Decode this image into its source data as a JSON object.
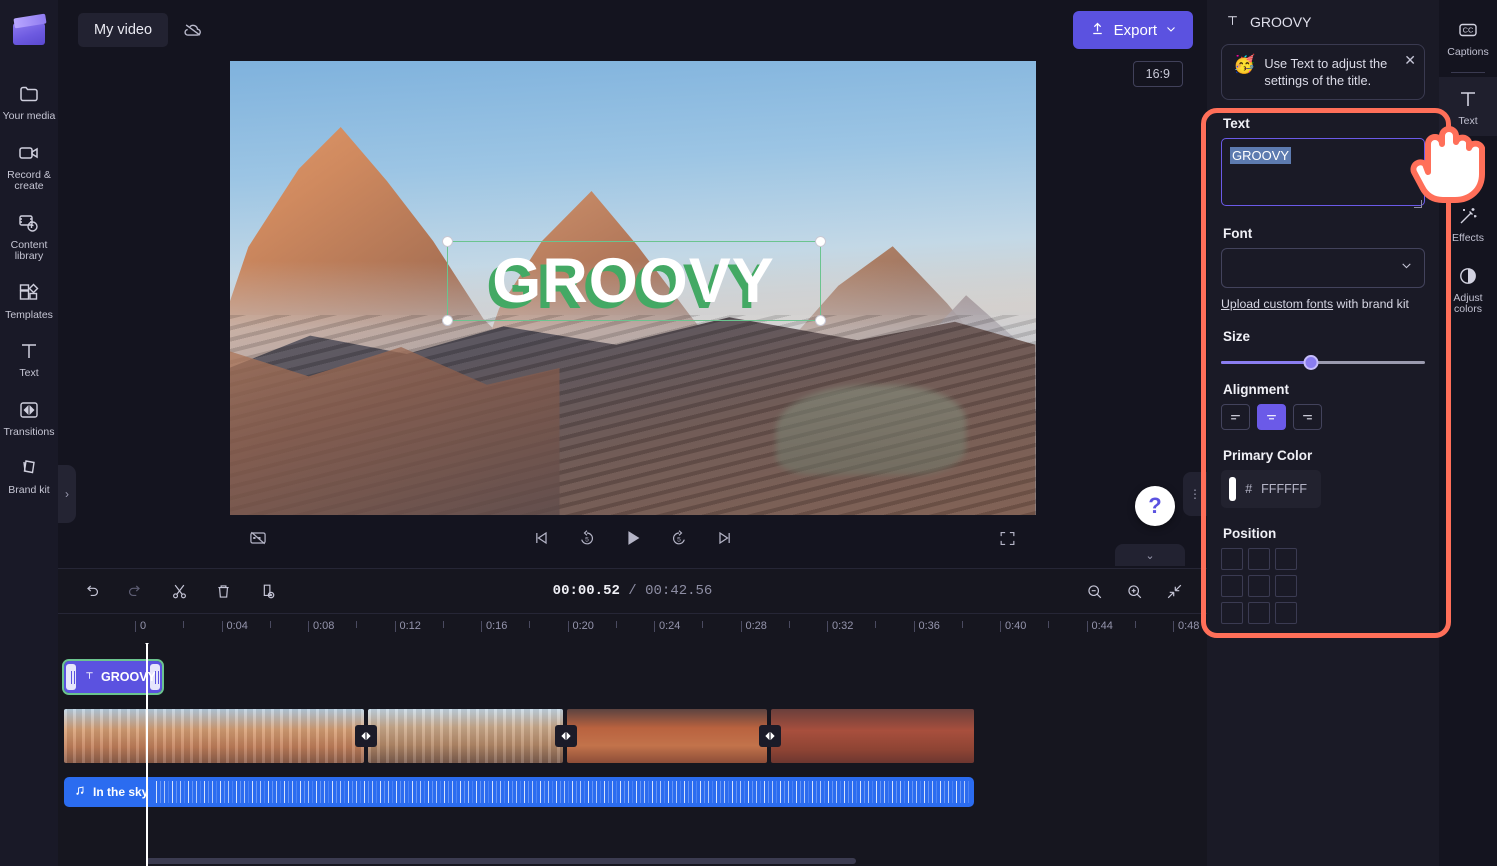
{
  "app": {
    "project_title": "My video",
    "cloud_status_icon": "cloud-off-icon",
    "export_label": "Export",
    "aspect_ratio": "16:9",
    "help_glyph": "?"
  },
  "sidebar": {
    "items": [
      {
        "label": "Your media",
        "icon": "folder-icon"
      },
      {
        "label": "Record & create",
        "icon": "video-camera-icon"
      },
      {
        "label": "Content library",
        "icon": "content-library-icon"
      },
      {
        "label": "Templates",
        "icon": "templates-icon"
      },
      {
        "label": "Text",
        "icon": "text-t-icon"
      },
      {
        "label": "Transitions",
        "icon": "transitions-icon"
      },
      {
        "label": "Brand kit",
        "icon": "brand-kit-icon"
      }
    ]
  },
  "preview": {
    "overlay_text": "GROOVY",
    "text_color": "#FFFFFF",
    "shadow_color": "#43A964",
    "controls": [
      {
        "name": "captions-off-icon"
      },
      {
        "name": "skip-to-start-icon"
      },
      {
        "name": "rewind-5-icon"
      },
      {
        "name": "play-icon"
      },
      {
        "name": "forward-5-icon"
      },
      {
        "name": "skip-to-end-icon"
      },
      {
        "name": "fullscreen-icon"
      }
    ]
  },
  "timeline": {
    "tools": [
      {
        "name": "undo-icon",
        "enabled": true
      },
      {
        "name": "redo-icon",
        "enabled": false
      },
      {
        "name": "split-scissors-icon",
        "enabled": true
      },
      {
        "name": "delete-trash-icon",
        "enabled": true
      },
      {
        "name": "duplicate-icon",
        "enabled": true
      }
    ],
    "current_time": "00:00.52",
    "total_time": "00:42.56",
    "time_separator": "/",
    "zoom_tools": [
      {
        "name": "zoom-out-icon"
      },
      {
        "name": "zoom-in-icon"
      },
      {
        "name": "fit-to-screen-icon"
      }
    ],
    "ruler_labels": [
      "0:04",
      "0:08",
      "0:12",
      "0:16",
      "0:20",
      "0:24",
      "0:28",
      "0:32",
      "0:36",
      "0:40",
      "0:44",
      "0:48"
    ],
    "text_clip_label": "GROOVY",
    "audio_clip_label": "In the sky",
    "audio_icon": "music-note-icon",
    "transition_icon": "transition-bowtie-icon",
    "transition_count": 3
  },
  "right_panel": {
    "header_title": "GROOVY",
    "header_icon": "text-t-icon",
    "tip": {
      "emoji": "🥳",
      "text": "Use Text to adjust the settings of the title.",
      "close_icon": "close-x-icon"
    },
    "text_section": {
      "label": "Text",
      "value": "GROOVY"
    },
    "font_section": {
      "label": "Font",
      "value": "",
      "chevron_icon": "chevron-down-icon",
      "upload_link": "Upload custom fonts",
      "upload_suffix": " with brand kit"
    },
    "size_section": {
      "label": "Size",
      "value_percent": 44
    },
    "alignment_section": {
      "label": "Alignment",
      "options": [
        "align-left-icon",
        "align-center-icon",
        "align-right-icon"
      ],
      "selected_index": 1
    },
    "color_section": {
      "label": "Primary Color",
      "hash": "#",
      "hex": "FFFFFF",
      "swatch": "#FFFFFF"
    },
    "position_section": {
      "label": "Position",
      "cells": 9
    },
    "highlight_color": "#FF6F59"
  },
  "right_rail": {
    "items": [
      {
        "label": "Captions",
        "icon": "closed-captions-icon",
        "active": false
      },
      {
        "label": "Text",
        "icon": "text-t-icon",
        "active": true
      },
      {
        "label": "Effects",
        "icon": "effects-wand-icon",
        "active": false
      },
      {
        "label": "Adjust colors",
        "icon": "adjust-colors-icon",
        "active": false
      }
    ]
  }
}
